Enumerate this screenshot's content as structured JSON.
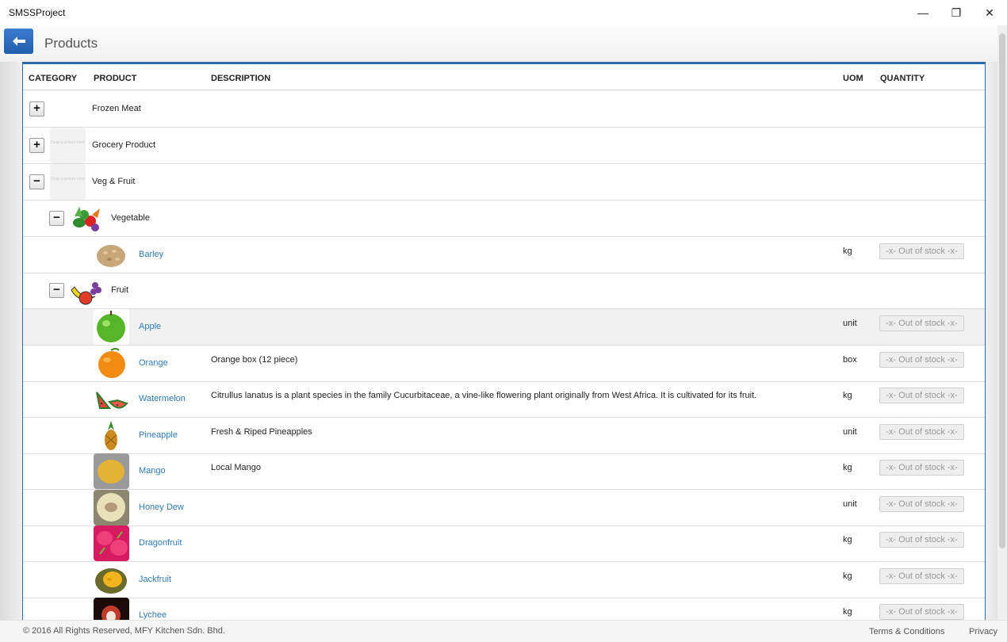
{
  "window": {
    "title": "SMSSProject",
    "minimize_glyph": "—",
    "maximize_glyph": "❐",
    "close_glyph": "✕"
  },
  "header": {
    "title": "Products",
    "back_icon": "back-arrow-icon",
    "accent": "#2f6aa6"
  },
  "table": {
    "columns": {
      "category": "CATEGORY",
      "product": "PRODUCT",
      "description": "DESCRIPTION",
      "uom": "UOM",
      "quantity": "QUANTITY"
    },
    "placeholder_text": "Drag a picture here",
    "categories": [
      {
        "label": "Frozen Meat",
        "toggle": "+"
      },
      {
        "label": "Grocery Product",
        "toggle": "+"
      },
      {
        "label": "Veg & Fruit",
        "toggle": "−"
      }
    ],
    "subcategories": [
      {
        "label": "Vegetable",
        "toggle": "−"
      },
      {
        "label": "Fruit",
        "toggle": "−"
      }
    ],
    "stock_label": "-x- Out of stock -x-",
    "products": [
      {
        "name": "Barley",
        "description": "",
        "uom": "kg"
      },
      {
        "name": "Apple",
        "description": "",
        "uom": "unit"
      },
      {
        "name": "Orange",
        "description": "Orange box (12 piece)",
        "uom": "box"
      },
      {
        "name": "Watermelon",
        "description": "Citrullus lanatus is a plant species in the family Cucurbitaceae, a vine-like flowering plant originally from West Africa. It is cultivated for its fruit.",
        "uom": "kg"
      },
      {
        "name": "Pineapple",
        "description": "Fresh & Riped Pineapples",
        "uom": "unit"
      },
      {
        "name": "Mango",
        "description": "Local Mango",
        "uom": "kg"
      },
      {
        "name": "Honey Dew",
        "description": "",
        "uom": "unit"
      },
      {
        "name": "Dragonfruit",
        "description": "",
        "uom": "kg"
      },
      {
        "name": "Jackfruit",
        "description": "",
        "uom": "kg"
      },
      {
        "name": "Lychee",
        "description": "",
        "uom": "kg"
      }
    ]
  },
  "footer": {
    "copyright": "© 2016 All Rights Reserved, MFY Kitchen Sdn. Bhd.",
    "terms": "Terms & Conditions",
    "privacy": "Privacy"
  }
}
